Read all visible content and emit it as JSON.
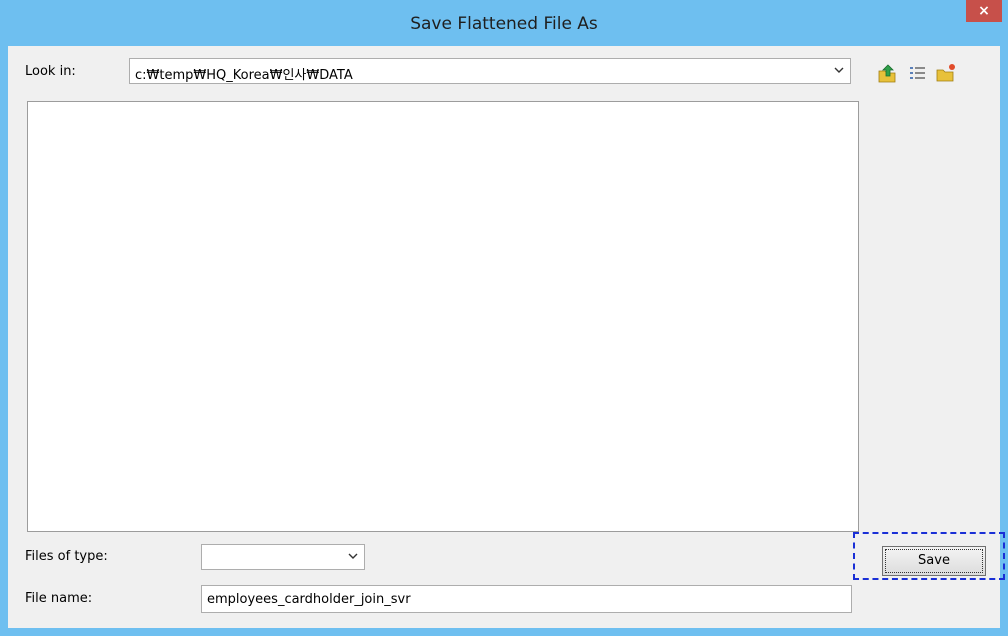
{
  "window": {
    "title": "Save Flattened File As",
    "close_label": "×"
  },
  "look_in": {
    "label": "Look in:",
    "value": "c:₩temp₩HQ_Korea₩인사₩DATA"
  },
  "toolbar": {
    "icons": [
      "up-folder-icon",
      "details-view-icon",
      "new-folder-icon"
    ]
  },
  "files_of_type": {
    "label": "Files of type:",
    "value": ""
  },
  "file_name": {
    "label": "File name:",
    "value": "employees_cardholder_join_svr"
  },
  "save_button": {
    "label": "Save"
  }
}
